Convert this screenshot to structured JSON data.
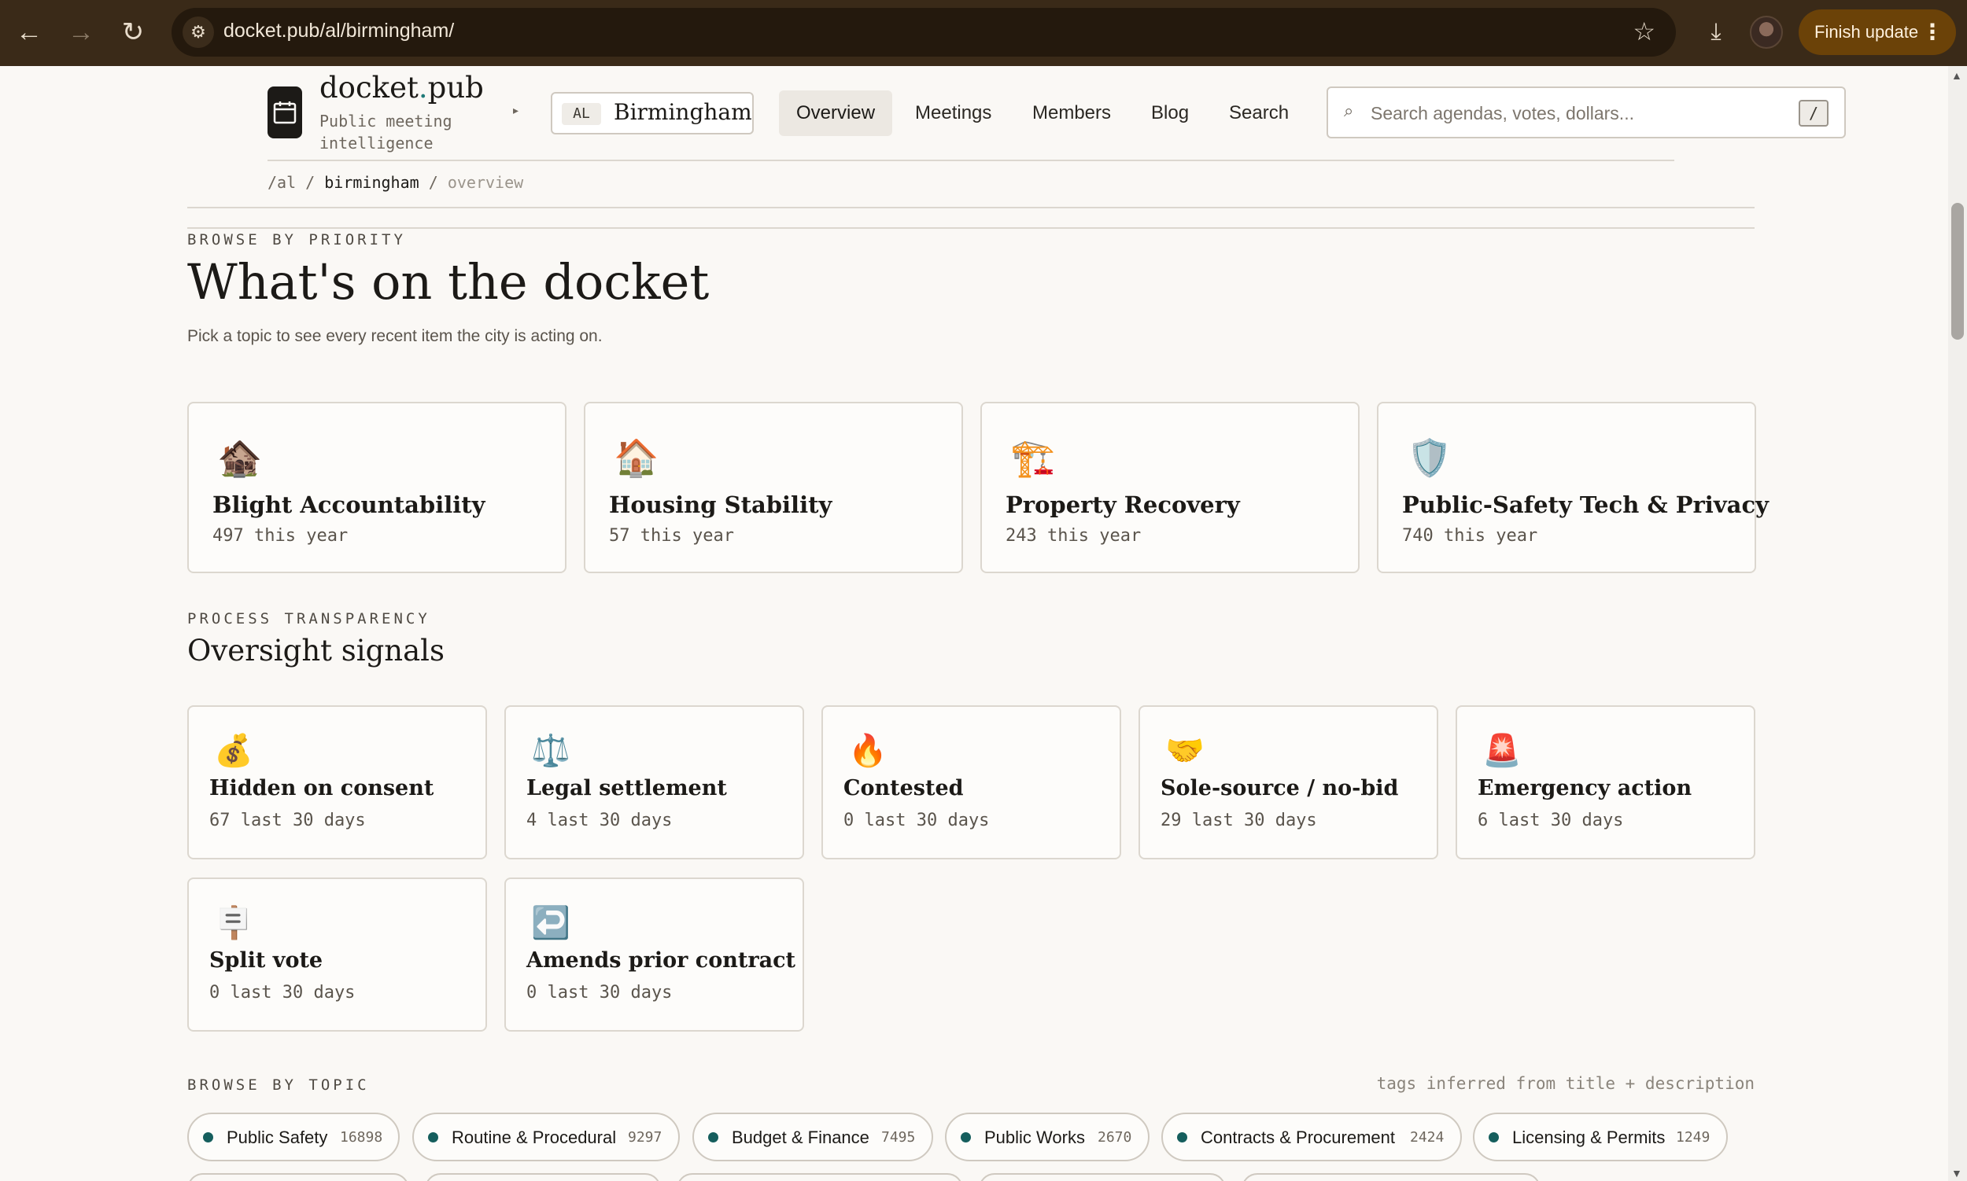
{
  "browser": {
    "url": "docket.pub/al/birmingham/",
    "update_label": "Finish update"
  },
  "site": {
    "brand_prefix": "docket",
    "brand_dot": ".",
    "brand_suffix": "pub",
    "tagline": "Public meeting intelligence",
    "state": "AL",
    "city": "Birmingham",
    "nav": [
      "Overview",
      "Meetings",
      "Members",
      "Blog",
      "Search"
    ],
    "active_nav": "Overview",
    "search_placeholder": "Search agendas, votes, dollars...",
    "search_shortcut": "/",
    "breadcrumb": {
      "root": "/al",
      "sep": "/",
      "city": "birmingham",
      "page": "overview"
    }
  },
  "priority": {
    "eyebrow": "BROWSE BY PRIORITY",
    "heading": "What's on the docket",
    "subheading": "Pick a topic to see every recent item the city is acting on.",
    "cards": [
      {
        "icon": "derelict-house-icon",
        "emoji": "🏚️",
        "title": "Blight Accountability",
        "count": "497 this year"
      },
      {
        "icon": "house-icon",
        "emoji": "🏠",
        "title": "Housing Stability",
        "count": "57 this year"
      },
      {
        "icon": "construction-crane-icon",
        "emoji": "🏗️",
        "title": "Property Recovery",
        "count": "243 this year"
      },
      {
        "icon": "shield-icon",
        "emoji": "🛡️",
        "title": "Public-Safety Tech & Privacy",
        "count": "740 this year"
      }
    ]
  },
  "oversight": {
    "eyebrow": "PROCESS TRANSPARENCY",
    "heading": "Oversight signals",
    "cards": [
      {
        "icon": "money-bag-icon",
        "emoji": "💰",
        "title": "Hidden on consent",
        "count": "67 last 30 days"
      },
      {
        "icon": "scales-icon",
        "emoji": "⚖️",
        "title": "Legal settlement",
        "count": "4 last 30 days"
      },
      {
        "icon": "fire-icon",
        "emoji": "🔥",
        "title": "Contested",
        "count": "0 last 30 days"
      },
      {
        "icon": "handshake-icon",
        "emoji": "🤝",
        "title": "Sole-source / no-bid",
        "count": "29 last 30 days"
      },
      {
        "icon": "siren-icon",
        "emoji": "🚨",
        "title": "Emergency action",
        "count": "6 last 30 days"
      },
      {
        "icon": "placard-icon",
        "emoji": "🪧",
        "title": "Split vote",
        "count": "0 last 30 days"
      },
      {
        "icon": "return-arrow-icon",
        "emoji": "↩️",
        "title": "Amends prior contract",
        "count": "0 last 30 days"
      }
    ]
  },
  "topics": {
    "eyebrow": "BROWSE BY TOPIC",
    "note": "tags inferred from title + description",
    "chips": [
      {
        "name": "Public Safety",
        "count": "16898"
      },
      {
        "name": "Routine & Procedural",
        "count": "9297"
      },
      {
        "name": "Budget & Finance",
        "count": "7495"
      },
      {
        "name": "Public Works",
        "count": "2670"
      },
      {
        "name": "Contracts & Procurement",
        "count": "2424"
      },
      {
        "name": "Licensing & Permits",
        "count": "1249"
      }
    ]
  },
  "colors": {
    "accent": "#1f7a78",
    "chip_dot": "#155e5d",
    "browser_frame": "#3a2a18",
    "update_button": "#6b4208",
    "page_bg": "#faf8f5"
  }
}
